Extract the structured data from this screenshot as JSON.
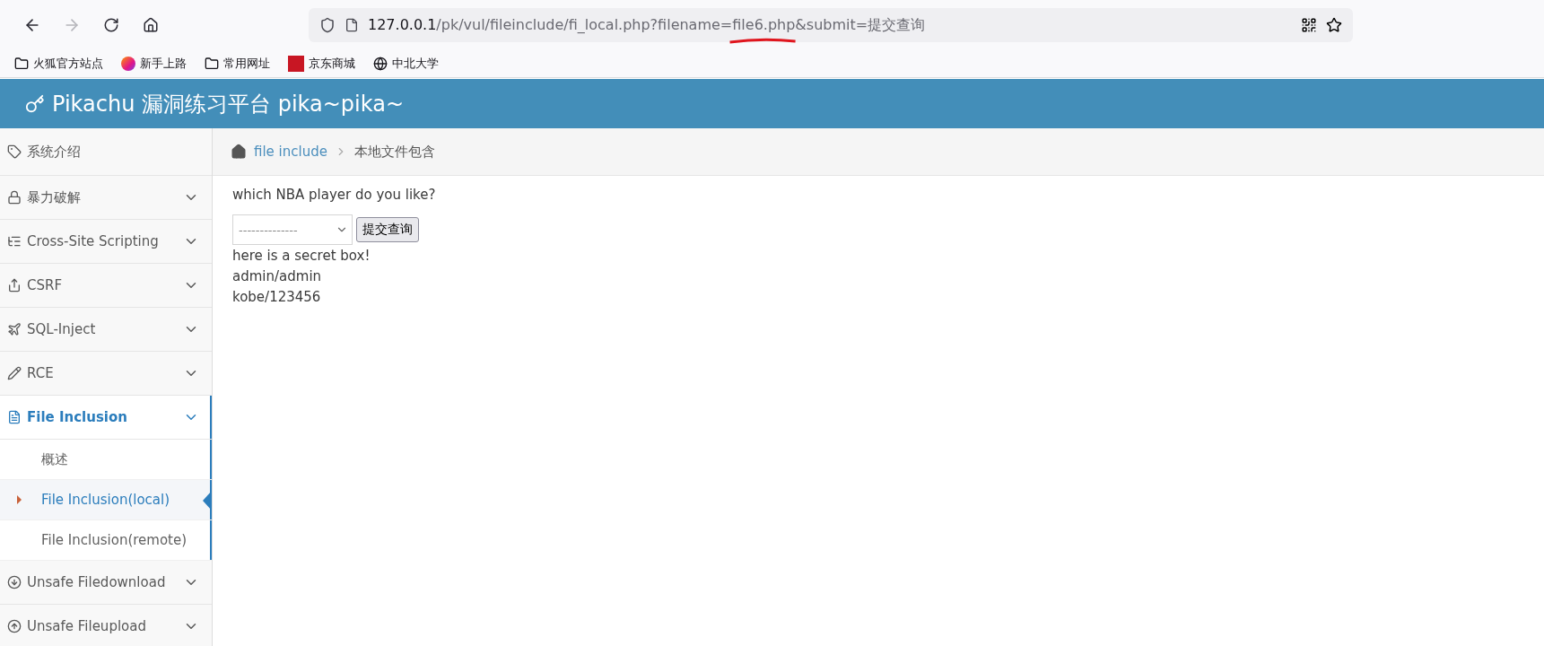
{
  "browser": {
    "url_parts": [
      {
        "kind": "host",
        "text": "127.0.0.1"
      },
      {
        "kind": "path",
        "text": "/pk/vul/fileinclude/fi_local.php?filename="
      },
      {
        "kind": "marked",
        "text": "file6.php"
      },
      {
        "kind": "path",
        "text": "&submit=提交查询"
      }
    ],
    "bookmarks": [
      {
        "label": "火狐官方站点"
      },
      {
        "label": "新手上路"
      },
      {
        "label": "常用网址"
      },
      {
        "label": "京东商城"
      },
      {
        "label": "中北大学"
      }
    ]
  },
  "header": {
    "title": "Pikachu 漏洞练习平台 pika~pika~"
  },
  "sidebar": {
    "items": [
      {
        "label": "系统介绍",
        "selected": false,
        "expanded": false
      },
      {
        "label": "暴力破解",
        "selected": false,
        "expanded": false
      },
      {
        "label": "Cross-Site Scripting",
        "selected": false,
        "expanded": false
      },
      {
        "label": "CSRF",
        "selected": false,
        "expanded": false
      },
      {
        "label": "SQL-Inject",
        "selected": false,
        "expanded": false
      },
      {
        "label": "RCE",
        "selected": false,
        "expanded": false
      },
      {
        "label": "File Inclusion",
        "selected": true,
        "expanded": true,
        "children": [
          {
            "label": "概述",
            "selected": false
          },
          {
            "label": "File Inclusion(local)",
            "selected": true
          },
          {
            "label": "File Inclusion(remote)",
            "selected": false
          }
        ]
      },
      {
        "label": "Unsafe Filedownload",
        "selected": false,
        "expanded": false
      },
      {
        "label": "Unsafe Fileupload",
        "selected": false,
        "expanded": false
      }
    ]
  },
  "breadcrumb": [
    {
      "label": "file include",
      "kind": "link"
    },
    {
      "label": "本地文件包含",
      "kind": "current"
    }
  ],
  "content": {
    "question": "which NBA player do you like?",
    "select_value": "--------------",
    "submit": "提交查询",
    "lines": [
      "here is a secret box!",
      "admin/admin",
      "kobe/123456"
    ]
  }
}
